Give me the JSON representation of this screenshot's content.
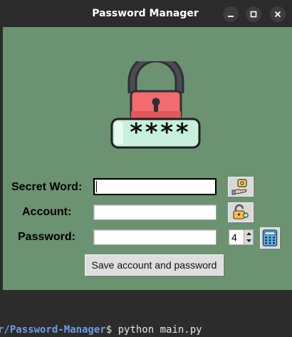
{
  "window": {
    "title": "Password Manager",
    "controls": {
      "minimize_icon": "minimize-icon",
      "maximize_icon": "maximize-icon",
      "close_icon": "close-icon"
    }
  },
  "colors": {
    "background": "#6b9271",
    "titlebar": "#2b2b2b",
    "lock_body": "#f16b6f",
    "keypad_bar": "#c8f0dc"
  },
  "header_icon": {
    "name": "padlock-password-icon",
    "password_mask": "****"
  },
  "form": {
    "secret_word": {
      "label": "Secret Word:",
      "value": "",
      "button_icon": "hand-key-icon"
    },
    "account": {
      "label": "Account:",
      "value": "",
      "button_icon": "unlock-icon"
    },
    "password": {
      "label": "Password:",
      "value": "",
      "length": "4",
      "button_icon": "calculator-icon"
    },
    "save_label": "Save account and password"
  },
  "terminal": {
    "path": "r/Password-Manager",
    "prompt": "$",
    "command": " python main.py"
  }
}
